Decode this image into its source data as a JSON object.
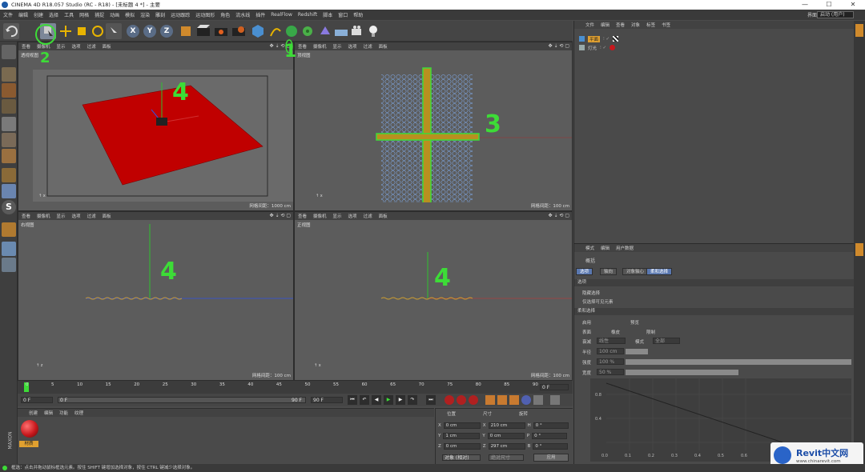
{
  "window": {
    "title": "CINEMA 4D R18.057 Studio (RC - R18) - [未标题 4 *] - 主要",
    "minimize": "—",
    "maximize": "☐",
    "close": "✕"
  },
  "menu": [
    "文件",
    "编辑",
    "创建",
    "选择",
    "工具",
    "网格",
    "捕捉",
    "动画",
    "模拟",
    "渲染",
    "雕刻",
    "运动跟踪",
    "运动图形",
    "角色",
    "流水线",
    "插件",
    "RealFlow",
    "Redshift",
    "脚本",
    "窗口",
    "帮助"
  ],
  "layout": {
    "label": "界面",
    "value": "启动 (用户)"
  },
  "toolbar": {
    "x_label": "X",
    "y_label": "Y",
    "z_label": "Z"
  },
  "viewport_menu": [
    "查看",
    "摄像机",
    "显示",
    "选项",
    "过滤",
    "面板"
  ],
  "viewports": [
    {
      "name": "透视视图",
      "info": "网格间距：1000 cm"
    },
    {
      "name": "顶视图",
      "info": "网格间距：100 cm"
    },
    {
      "name": "右视图",
      "info": "网格间距：100 cm"
    },
    {
      "name": "正视图",
      "info": "网格间距：100 cm"
    }
  ],
  "annotations": [
    "1",
    "2",
    "3",
    "4",
    "4",
    "4",
    "5"
  ],
  "timeline": {
    "ticks": [
      "0",
      "5",
      "10",
      "15",
      "20",
      "25",
      "30",
      "35",
      "40",
      "45",
      "50",
      "55",
      "60",
      "65",
      "70",
      "75",
      "80",
      "85",
      "90"
    ],
    "frame_field": "0 F",
    "start": "0 F",
    "current": "0 F",
    "end": "90 F",
    "end2": "90 F"
  },
  "material_panel": {
    "menu": [
      "创建",
      "编辑",
      "功能",
      "纹理"
    ],
    "material_name": "材质"
  },
  "coord_panel": {
    "headers": [
      "位置",
      "尺寸",
      "旋转"
    ],
    "rows": [
      {
        "axis": "X",
        "pos": "0 cm",
        "saxis": "X",
        "size": "210 cm",
        "raxis": "H",
        "rot": "0 °"
      },
      {
        "axis": "Y",
        "pos": "1 cm",
        "saxis": "Y",
        "size": "0 cm",
        "raxis": "P",
        "rot": "0 °"
      },
      {
        "axis": "Z",
        "pos": "0 cm",
        "saxis": "Z",
        "size": "297 cm",
        "raxis": "B",
        "rot": "0 °"
      }
    ],
    "mode": "对象 (相对)",
    "size_mode": "绝对尺寸",
    "apply": "应用"
  },
  "object_manager": {
    "menu": [
      "文件",
      "编辑",
      "查看",
      "对象",
      "标签",
      "书签"
    ],
    "objects": [
      "平面",
      "灯光"
    ]
  },
  "attribute_manager": {
    "menu": [
      "模式",
      "编辑",
      "用户数据"
    ],
    "title": "概括",
    "tabs": [
      "选项",
      "轴向",
      "对象轴心",
      "柔和选择"
    ],
    "sections": [
      "选项",
      "柔和选择"
    ],
    "rows": [
      "隐藏选择",
      "仅选择可见元素",
      "启用",
      "预览",
      "表面",
      "橡皮",
      "限制",
      "衰减",
      "模式",
      "半径",
      "强度",
      "宽度"
    ],
    "values": {
      "radius": "100 cm",
      "strength": "100 %",
      "width": "50 %",
      "falloff": "线性",
      "mode": "全部"
    }
  },
  "graph": {
    "y_ticks": [
      "0.8",
      "0.4"
    ],
    "x_ticks": [
      "0.0",
      "0.1",
      "0.2",
      "0.3",
      "0.4",
      "0.5",
      "0.6"
    ]
  },
  "status": "框选：点击并拖动鼠标框选元素。按住 SHIFT 键增加选择对象，按住 CTRL 键减少选择对象。",
  "watermark": {
    "brand": "Revit中文网",
    "url": "www.chinarevit.com"
  },
  "colors": {
    "accent_green": "#3ddc37",
    "plane_red": "#c00000",
    "material_red": "#c8181d"
  }
}
